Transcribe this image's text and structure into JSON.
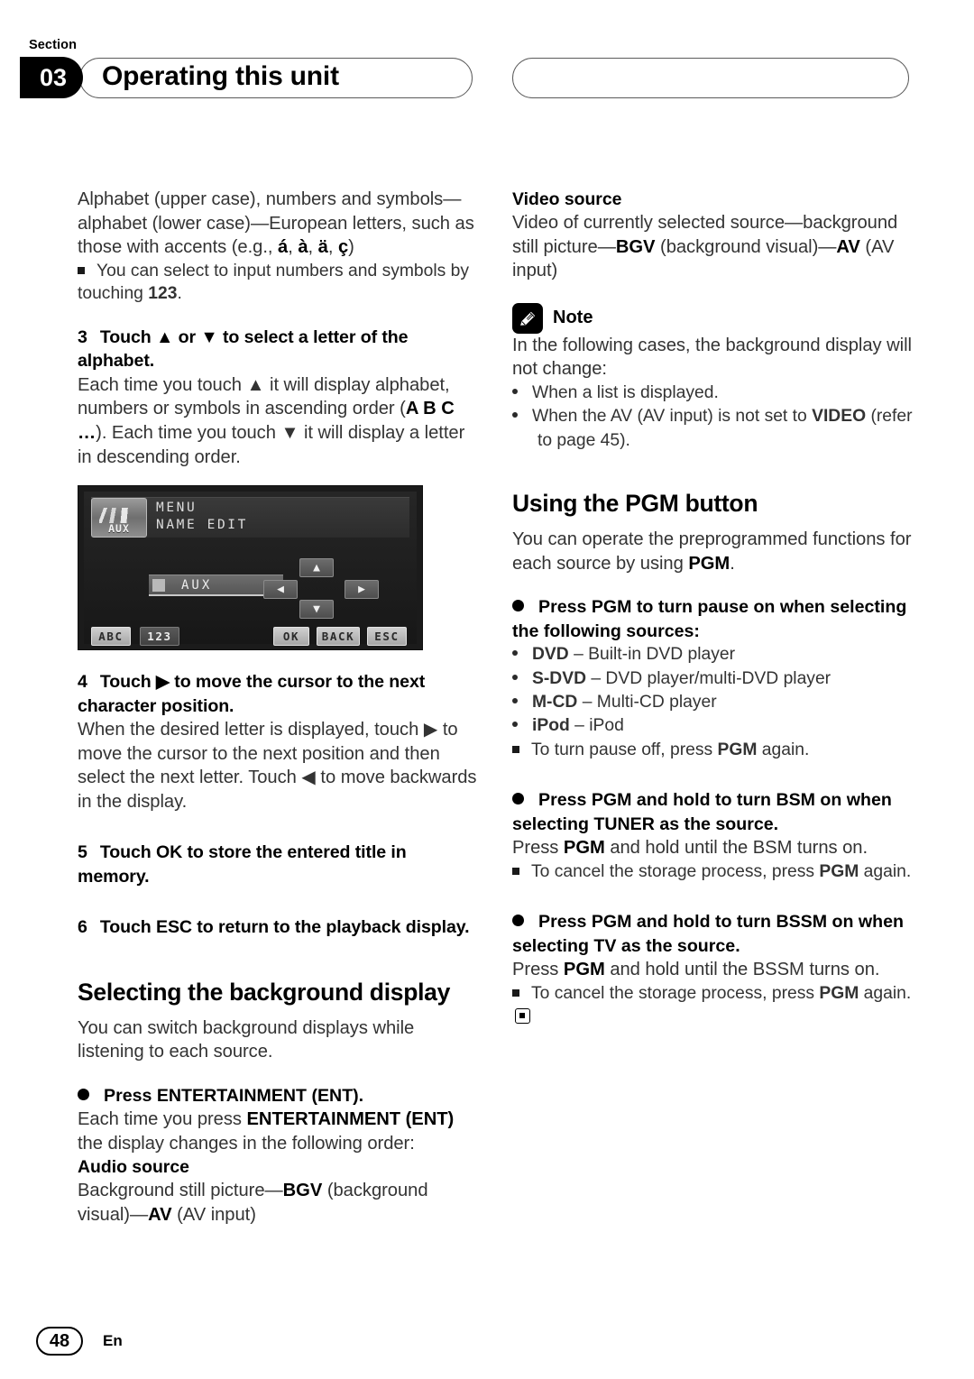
{
  "header": {
    "section_label": "Section",
    "section_number": "03",
    "title": "Operating this unit"
  },
  "left_column": {
    "intro_paragraph_html": "Alphabet (upper case), numbers and symbols—alphabet (lower case)—European letters, such as those with accents (e.g., <b>á</b>, <b>à</b>, <b>ä</b>, <b>ç</b>)",
    "intro_note_html": "You can select to input numbers and symbols by touching <b>123</b>.",
    "step3": {
      "number": "3",
      "heading": "Touch ▲ or ▼ to select a letter of the alphabet.",
      "body_html": "Each time you touch ▲ it will display alphabet, numbers or symbols in ascending order (<b>A B C …</b>). Each time you touch ▼ it will display a letter in descending order."
    },
    "lcd": {
      "badge_text": "AUX",
      "menu_line1": "MENU",
      "menu_line2": "NAME EDIT",
      "field_value": "AUX",
      "field_enter_glyph": "↵",
      "btn_up": "▲",
      "btn_down": "▼",
      "btn_left": "◀",
      "btn_right": "▶",
      "key_abc": "ABC",
      "key_123": "123",
      "key_ok": "OK",
      "key_back": "BACK",
      "key_esc": "ESC"
    },
    "step4": {
      "number": "4",
      "heading": "Touch ▶ to move the cursor to the next character position.",
      "body": "When the desired letter is displayed, touch ▶ to move the cursor to the next position and then select the next letter. Touch ◀ to move backwards in the display."
    },
    "step5": {
      "number": "5",
      "heading": "Touch OK to store the entered title in memory."
    },
    "step6": {
      "number": "6",
      "heading": "Touch ESC to return to the playback display."
    },
    "section_bg": {
      "title": "Selecting the background display",
      "intro": "You can switch background displays while listening to each source.",
      "bullet_heading": "Press ENTERTAINMENT (ENT).",
      "body_html": "Each time you press <b>ENTERTAINMENT (ENT)</b> the display changes in the following order:",
      "audio_source_label": "Audio source",
      "audio_source_html": "Background still picture—<b>BGV</b> (background visual)—<b>AV</b> (AV input)"
    }
  },
  "right_column": {
    "video_source_label": "Video source",
    "video_source_html": "Video of currently selected source—background still picture—<b>BGV</b> (background visual)—<b>AV</b> (AV input)",
    "note": {
      "icon": "pencil-icon",
      "label": "Note",
      "intro": "In the following cases, the background display will not change:",
      "items_html": [
        "When a list is displayed.",
        "When the AV (AV input) is not set to <b>VIDEO</b> (refer to page 45)."
      ]
    },
    "pgm": {
      "title": "Using the PGM button",
      "intro_html": "You can operate the preprogrammed functions for each source by using <b>PGM</b>.",
      "b1_heading": "Press PGM to turn pause on when selecting the following sources:",
      "b1_items_html": [
        "<b>DVD</b> – Built-in DVD player",
        "<b>S-DVD</b> – DVD player/multi-DVD player",
        "<b>M-CD</b> – Multi-CD player",
        "<b>iPod</b> – iPod"
      ],
      "b1_note_html": "To turn pause off, press <b>PGM</b> again.",
      "b2_heading": "Press PGM and hold to turn BSM on when selecting TUNER as the source.",
      "b2_body_html": "Press <b>PGM</b> and hold until the BSM turns on.",
      "b2_note_html": "To cancel the storage process, press <b>PGM</b> again.",
      "b3_heading": "Press PGM and hold to turn BSSM on when selecting TV as the source.",
      "b3_body_html": "Press <b>PGM</b> and hold until the BSSM turns on.",
      "b3_note_html": "To cancel the storage process, press <b>PGM</b> again."
    }
  },
  "footer": {
    "page_number": "48",
    "language": "En"
  }
}
